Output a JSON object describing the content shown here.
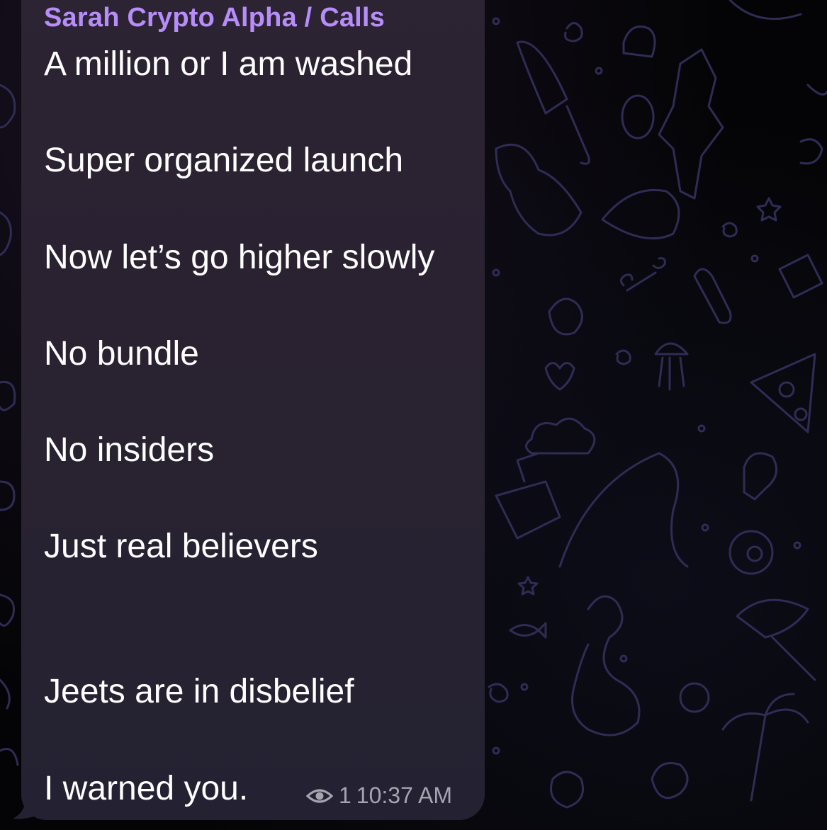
{
  "chat": {
    "sender_name": "Sarah Crypto Alpha / Calls",
    "lines": [
      "A million or I am washed",
      "Super organized launch",
      "Now let’s go higher slowly",
      "No bundle",
      "No insiders",
      "Just real believers",
      "Jeets are in disbelief",
      "I warned you."
    ],
    "view_count": "1",
    "time": "10:37 AM"
  },
  "icons": {
    "views": "eye-icon"
  },
  "colors": {
    "background": "#050507",
    "bubble": "#2a2231",
    "sender": "#b78dfa",
    "text": "#ffffff",
    "meta": "#a7a3b0",
    "doodles": "#2e2c52"
  }
}
